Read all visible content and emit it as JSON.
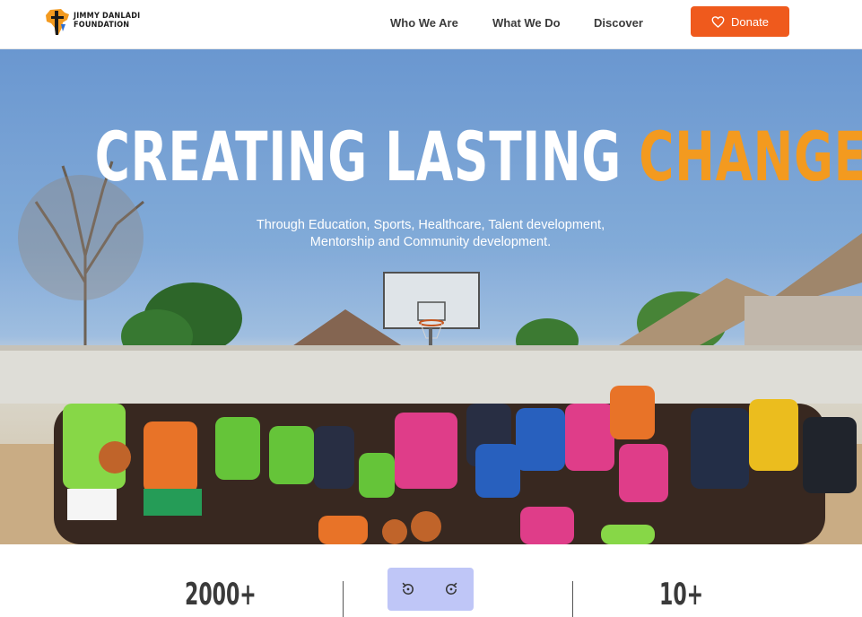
{
  "brand": {
    "logo_line1": "Jimmy Danladi",
    "logo_line2": "Foundation"
  },
  "nav": {
    "items": [
      "Who We Are",
      "What We Do",
      "Discover"
    ],
    "donate_label": "Donate"
  },
  "hero": {
    "title_main": "CREATING LASTING ",
    "title_accent": "CHANGE",
    "subtitle_line1": "Through Education, Sports, Healthcare, Talent development,",
    "subtitle_line2": "Mentorship and Community development."
  },
  "stats": {
    "left_value": "2000+",
    "right_value": "10+"
  },
  "colors": {
    "accent_orange": "#ef5a1d",
    "title_accent": "#f39a1f",
    "carousel_bg": "#bfc6f7"
  },
  "icons": {
    "donate": "heart-icon",
    "prev": "rotate-left-icon",
    "next": "rotate-right-icon"
  }
}
